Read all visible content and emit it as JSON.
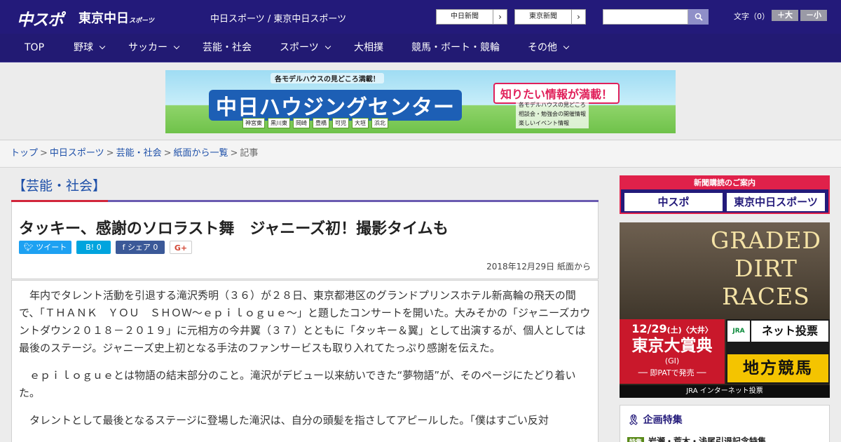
{
  "header": {
    "logo_main": "中スポ",
    "logo_tokyo": "東京中日",
    "logo_tokyo_sub": "スポーツ",
    "site_names": "中日スポーツ / 東京中日スポーツ",
    "ext_links": [
      {
        "label": "中日新聞"
      },
      {
        "label": "東京新聞"
      }
    ],
    "search_placeholder": "",
    "font_size_label": "文字（0）",
    "font_bigger": "＋大",
    "font_smaller": "－小"
  },
  "nav": {
    "items": [
      {
        "label": "TOP",
        "has_menu": false
      },
      {
        "label": "野球",
        "has_menu": true
      },
      {
        "label": "サッカー",
        "has_menu": true
      },
      {
        "label": "芸能・社会",
        "has_menu": false
      },
      {
        "label": "スポーツ",
        "has_menu": true
      },
      {
        "label": "大相撲",
        "has_menu": false
      },
      {
        "label": "競馬・ボート・競輪",
        "has_menu": false
      },
      {
        "label": "その他",
        "has_menu": true
      }
    ]
  },
  "banner": {
    "tag": "各モデルハウスの見どころ満載！",
    "title": "中日ハウジングセンター",
    "towns": [
      "神宮東",
      "黒川東",
      "岡崎",
      "豊橋",
      "可児",
      "大垣",
      "浜北"
    ],
    "headline": "知りたい情報が満載！",
    "list": [
      "各モデルハウスの見どころ",
      "相談会・勉強会の開催情報",
      "楽しいイベント情報"
    ]
  },
  "breadcrumb": {
    "links": [
      "トップ",
      "中日スポーツ",
      "芸能・社会",
      "紙面から一覧"
    ],
    "current": "記事"
  },
  "article": {
    "category": "【芸能・社会】",
    "title": "タッキー、感謝のソロラスト舞　ジャニーズ初！撮影タイムも",
    "share": {
      "tweet": "ツイート",
      "hatena": "B! 0",
      "facebook": "シェア 0",
      "gplus": "G+"
    },
    "date": "2018年12月29日 紙面から",
    "paragraphs": [
      "年内でタレント活動を引退する滝沢秀明（３６）が２８日、東京都港区のグランドプリンスホテル新高輪の飛天の間で、「ＴＨＡＮＫ　ＹＯＵ　ＳＨＯＷ～ｅｐｉｌｏｇｕｅ～」と題したコンサートを開いた。大みそかの「ジャニーズカウントダウン２０１８－２０１９」に元相方の今井翼（３７）とともに「タッキー＆翼」として出演するが、個人としては最後のステージ。ジャニーズ史上初となる手法のファンサービスも取り入れてたっぷり感謝を伝えた。",
      "ｅｐｉｌｏｇｕｅとは物語の結末部分のこと。滝沢がデビュー以来紡いできた“夢物語”が、そのページにたどり着いた。",
      "タレントとして最後となるステージに登場した滝沢は、自分の頭髪を指さしてアピールした。「僕はすごい反対"
    ]
  },
  "sidebar": {
    "subscribe": {
      "top": "新聞購読のご案内",
      "logo1": "中スポ",
      "logo2": "東京中日スポーツ"
    },
    "ad": {
      "title_lines": [
        "GRADED",
        "DIRT",
        "RACES"
      ],
      "date": "12/29",
      "date_sub": "(土)〈大井〉",
      "race": "東京大賞典",
      "grade": "(GI)",
      "pat": "── 即PATで発売 ──",
      "jra": "JRA",
      "net": "ネット投票",
      "chiho": "地方競馬",
      "footer": "JRA インターネット投票"
    },
    "feature": {
      "title": "企画特集",
      "row_badge": "特集",
      "row_text": "岩瀬・荒木・浅尾引退記念特集"
    }
  }
}
